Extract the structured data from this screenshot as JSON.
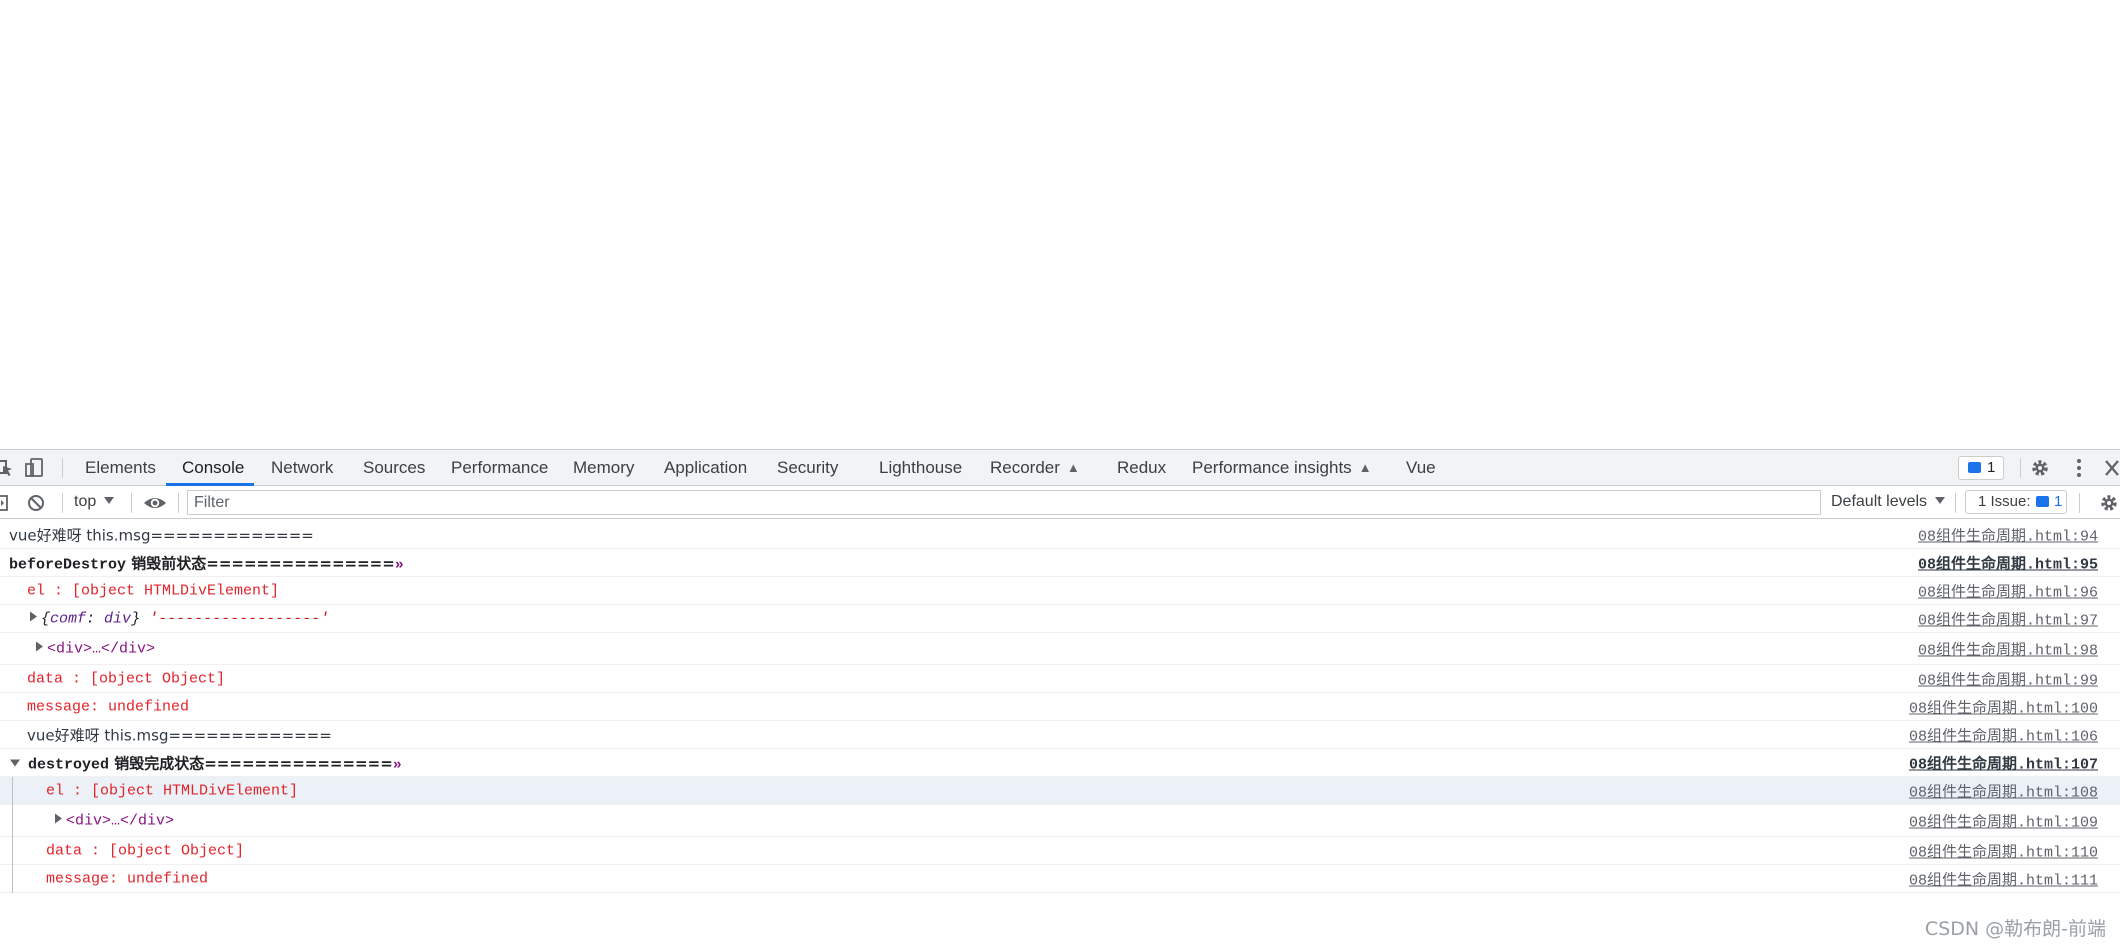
{
  "tabs": [
    "Elements",
    "Console",
    "Network",
    "Sources",
    "Performance",
    "Memory",
    "Application",
    "Security",
    "Lighthouse",
    "Recorder",
    "Redux",
    "Performance insights",
    "Vue"
  ],
  "active_tab": "Console",
  "message_count": "1",
  "filter": {
    "context": "top",
    "placeholder": "Filter",
    "levels": "Default levels"
  },
  "issues": {
    "label": "1 Issue:",
    "count": "1"
  },
  "logs": [
    {
      "text": "vue好难呀  this.msg=============",
      "src": "08组件生命周期.html:94"
    },
    {
      "label": "beforeDestroy",
      "text": " 销毁前状态===============",
      "src": "08组件生命周期.html:95"
    },
    {
      "text": "el : [object HTMLDivElement]",
      "src": "08组件生命周期.html:96"
    },
    {
      "key": "comf",
      "value": "div",
      "string": "'------------------'",
      "src": "08组件生命周期.html:97"
    },
    {
      "text": "<div>…</div>",
      "src": "08组件生命周期.html:98"
    },
    {
      "text": "data : [object Object]",
      "src": "08组件生命周期.html:99"
    },
    {
      "text": "message: undefined",
      "src": "08组件生命周期.html:100"
    },
    {
      "text": "vue好难呀  this.msg=============",
      "src": "08组件生命周期.html:106"
    },
    {
      "label": "destroyed",
      "text": " 销毁完成状态===============",
      "src": "08组件生命周期.html:107"
    },
    {
      "text": "el : [object HTMLDivElement]",
      "src": "08组件生命周期.html:108"
    },
    {
      "text": "<div>…</div>",
      "src": "08组件生命周期.html:109"
    },
    {
      "text": "data : [object Object]",
      "src": "08组件生命周期.html:110"
    },
    {
      "text": "message: undefined",
      "src": "08组件生命周期.html:111"
    }
  ],
  "watermark": "CSDN @勒布朗-前端",
  "colors": {
    "accent": "#1a73e8",
    "error_text": "#e0242b",
    "selected_row": "#ecf1f8"
  }
}
